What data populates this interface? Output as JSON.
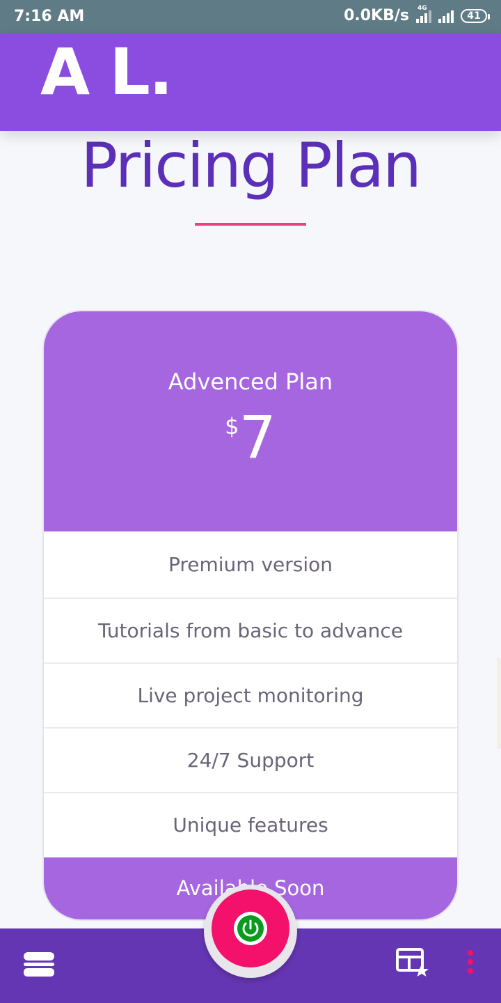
{
  "status_bar": {
    "time": "7:16 AM",
    "network_speed": "0.0KB/s",
    "network_type": "4G",
    "battery": "41"
  },
  "app_bar": {
    "logo_text": "A L."
  },
  "page": {
    "title": "Pricing Plan"
  },
  "pricing_card": {
    "plan_name": "Advenced Plan",
    "currency": "$",
    "price": "7",
    "features": [
      "Premium version",
      "Tutorials from basic to advance",
      "Live project monitoring",
      "24/7 Support",
      "Unique features"
    ],
    "footer_label": "Available Soon"
  },
  "bottom_nav": {
    "left_icon": "menu-icon",
    "fab_icon": "power-icon",
    "right_icon": "favorites-icon",
    "overflow_icon": "more-vert-icon"
  },
  "colors": {
    "status_bar": "#5f7b86",
    "app_bar": "#8a4de0",
    "title": "#5b2fb8",
    "accent_underline": "#ee3f7e",
    "card_header": "#a566e0",
    "bottom_bar": "#6536b3",
    "fab": "#f4116b",
    "power_green": "#0a9a1e"
  }
}
